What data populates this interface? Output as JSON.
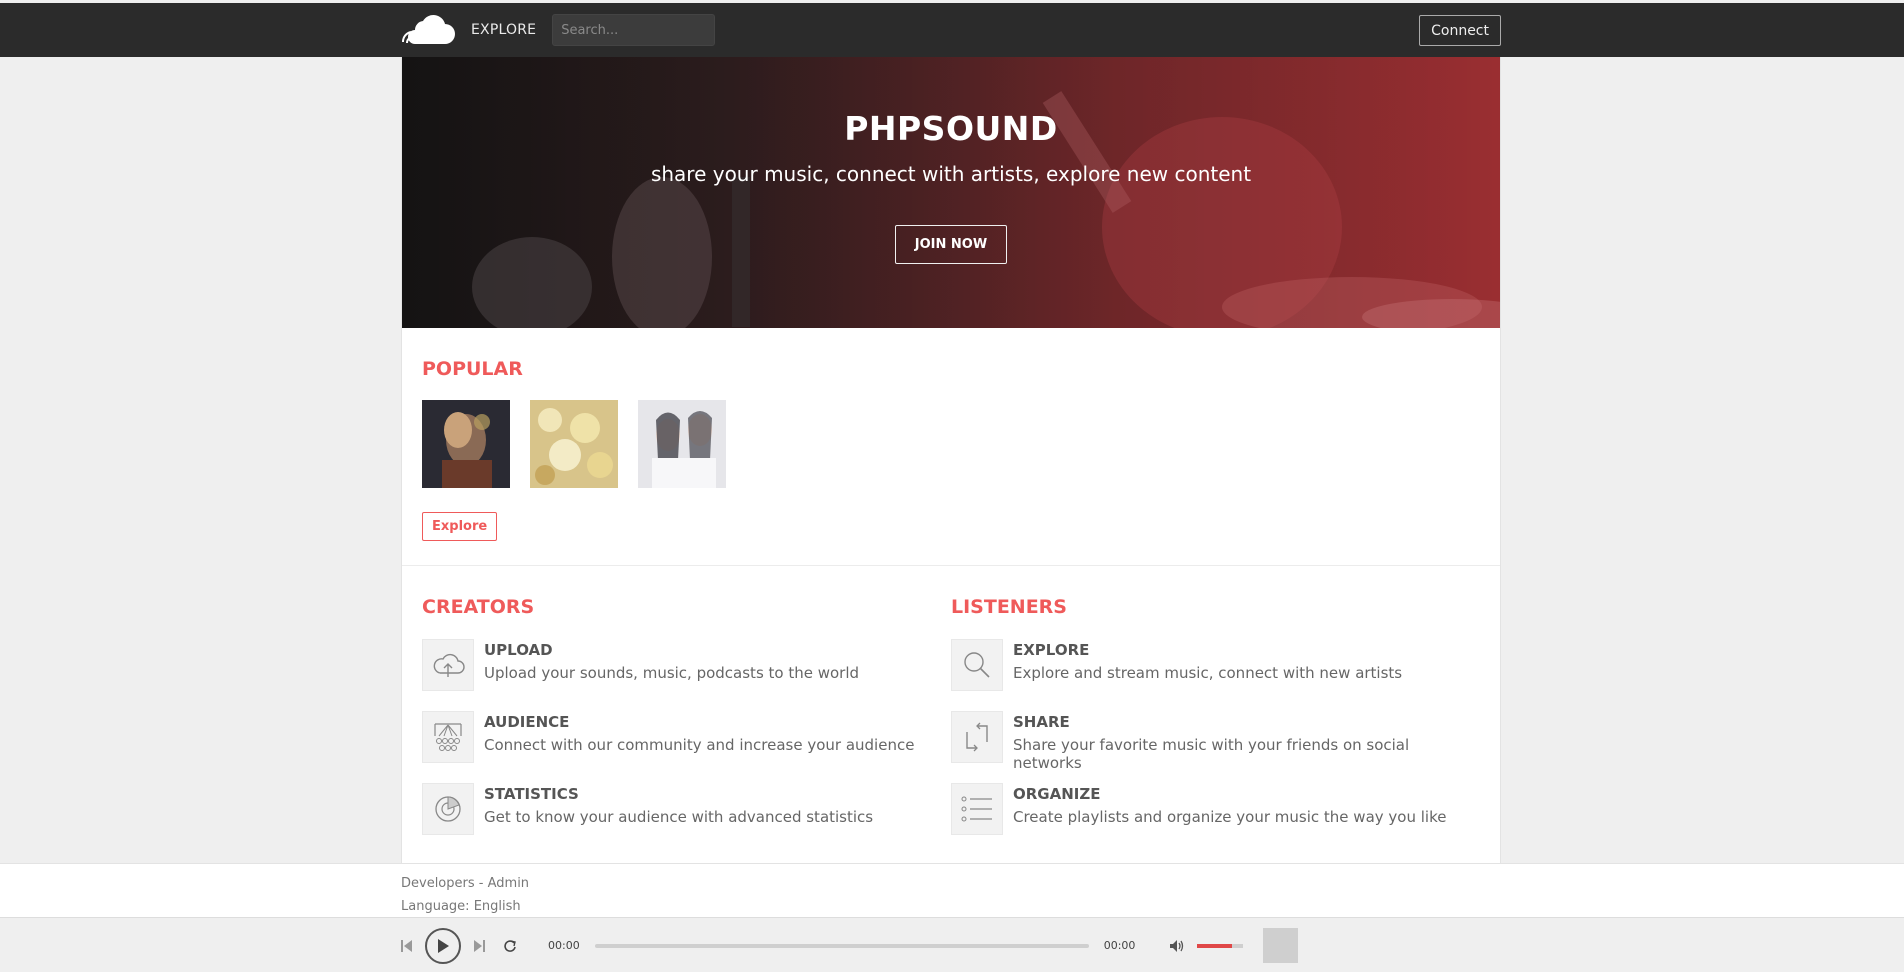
{
  "header": {
    "nav_explore": "EXPLORE",
    "search_placeholder": "Search...",
    "connect_label": "Connect"
  },
  "hero": {
    "title": "PHPSOUND",
    "subtitle": "share your music, connect with artists, explore new content",
    "join_label": "JOIN NOW",
    "accent_color": "#9a2e31"
  },
  "popular": {
    "title": "POPULAR",
    "explore_label": "Explore"
  },
  "creators": {
    "title": "CREATORS",
    "items": [
      {
        "title": "UPLOAD",
        "desc": "Upload your sounds, music, podcasts to the world",
        "icon": "cloud-upload-icon"
      },
      {
        "title": "AUDIENCE",
        "desc": "Connect with our community and increase your audience",
        "icon": "audience-icon"
      },
      {
        "title": "STATISTICS",
        "desc": "Get to know your audience with advanced statistics",
        "icon": "statistics-icon"
      }
    ]
  },
  "listeners": {
    "title": "LISTENERS",
    "items": [
      {
        "title": "EXPLORE",
        "desc": "Explore and stream music, connect with new artists",
        "icon": "search-icon"
      },
      {
        "title": "SHARE",
        "desc": "Share your favorite music with your friends on social networks",
        "icon": "share-icon"
      },
      {
        "title": "ORGANIZE",
        "desc": "Create playlists and organize your music the way you like",
        "icon": "list-icon"
      }
    ]
  },
  "footer": {
    "developers": "Developers",
    "separator": " - ",
    "admin": "Admin",
    "language_label": "Language:",
    "language_value": "English"
  },
  "player": {
    "current_time": "00:00",
    "duration": "00:00",
    "progress": 0,
    "volume": 0.75
  }
}
